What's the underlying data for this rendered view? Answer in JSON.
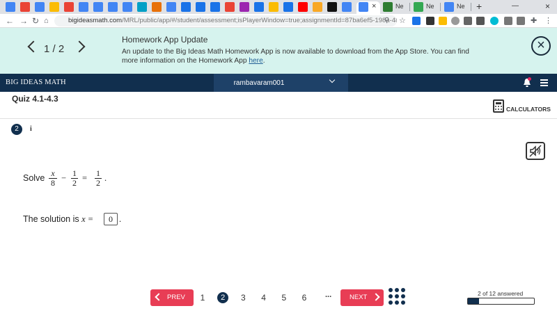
{
  "browser": {
    "tabs": [
      {
        "icon": "docs-icon",
        "color": "#4285f4"
      },
      {
        "icon": "office-icon",
        "color": "#ea4335"
      },
      {
        "icon": "docs-icon",
        "color": "#4285f4"
      },
      {
        "icon": "slides-icon",
        "color": "#fbbc04"
      },
      {
        "icon": "gmail-icon",
        "color": "#ea4335"
      },
      {
        "icon": "docs-icon",
        "color": "#4285f4"
      },
      {
        "icon": "docs-icon",
        "color": "#4285f4"
      },
      {
        "icon": "docs-icon",
        "color": "#4285f4"
      },
      {
        "icon": "docs-icon",
        "color": "#4285f4"
      },
      {
        "icon": "site-icon",
        "color": "#00a0c6"
      },
      {
        "icon": "flash-icon",
        "color": "#e8710a"
      },
      {
        "icon": "docs-icon",
        "color": "#4285f4"
      },
      {
        "icon": "meet-icon",
        "color": "#1a73e8"
      },
      {
        "icon": "meet-icon",
        "color": "#1a73e8"
      },
      {
        "icon": "meet-icon",
        "color": "#1a73e8"
      },
      {
        "icon": "gmail-icon",
        "color": "#ea4335"
      },
      {
        "icon": "site-icon",
        "color": "#9c27b0"
      },
      {
        "icon": "meet-icon",
        "color": "#1a73e8"
      },
      {
        "icon": "classroom-icon",
        "color": "#fbbc04"
      },
      {
        "icon": "meet-icon",
        "color": "#1a73e8"
      },
      {
        "icon": "youtube-icon",
        "color": "#ff0000"
      },
      {
        "icon": "site-icon",
        "color": "#f9a825"
      },
      {
        "icon": "site-icon",
        "color": "#111111"
      },
      {
        "icon": "google-icon",
        "color": "#4285f4"
      }
    ],
    "active_tab_close": "×",
    "other_tabs": [
      {
        "title": "Ne",
        "icon": "site-icon",
        "color": "#2e7d32"
      },
      {
        "title": "Ne",
        "icon": "classroom-icon",
        "color": "#34a853"
      },
      {
        "title": "Ne",
        "icon": "google-icon",
        "color": "#4285f4"
      }
    ],
    "new_tab": "+",
    "url_domain": "bigideasmath.com",
    "url_path": "/MRL/public/app/#/student/assessment;isPlayerWindow=true;assignmentId=87ba6ef5-198a-482a-..."
  },
  "banner": {
    "counter": "1 / 2",
    "title": "Homework App Update",
    "message": "An update to the Big Ideas Math Homework App is now available to download from the App Store. You can find more information on the Homework App ",
    "link": "here",
    "close": "×"
  },
  "header": {
    "brand": "BIG IDEAS MATH",
    "username": "rambavaram001"
  },
  "quiz": {
    "title": "Quiz 4.1-4.3",
    "calculators_label": "CALCULATORS",
    "question_number": "2",
    "info": "i",
    "solve_label": "Solve",
    "eq": {
      "n1": "x",
      "d1": "8",
      "minus": "−",
      "n2": "1",
      "d2": "2",
      "equals": "=",
      "n3": "1",
      "d3": "2",
      "period": "."
    },
    "solution_text": "The solution is",
    "solution_var": "x =",
    "answer_value": "0",
    "answer_period": "."
  },
  "pager": {
    "prev": "PREV",
    "next": "NEXT",
    "pages": [
      "1",
      "2",
      "3",
      "4",
      "5",
      "6"
    ],
    "current": "2",
    "ellipsis": "...",
    "answered_label": "2 of 12 answered",
    "answered_fraction": 0.1667,
    "accent": "#e83d55",
    "navy": "#112f4e"
  }
}
